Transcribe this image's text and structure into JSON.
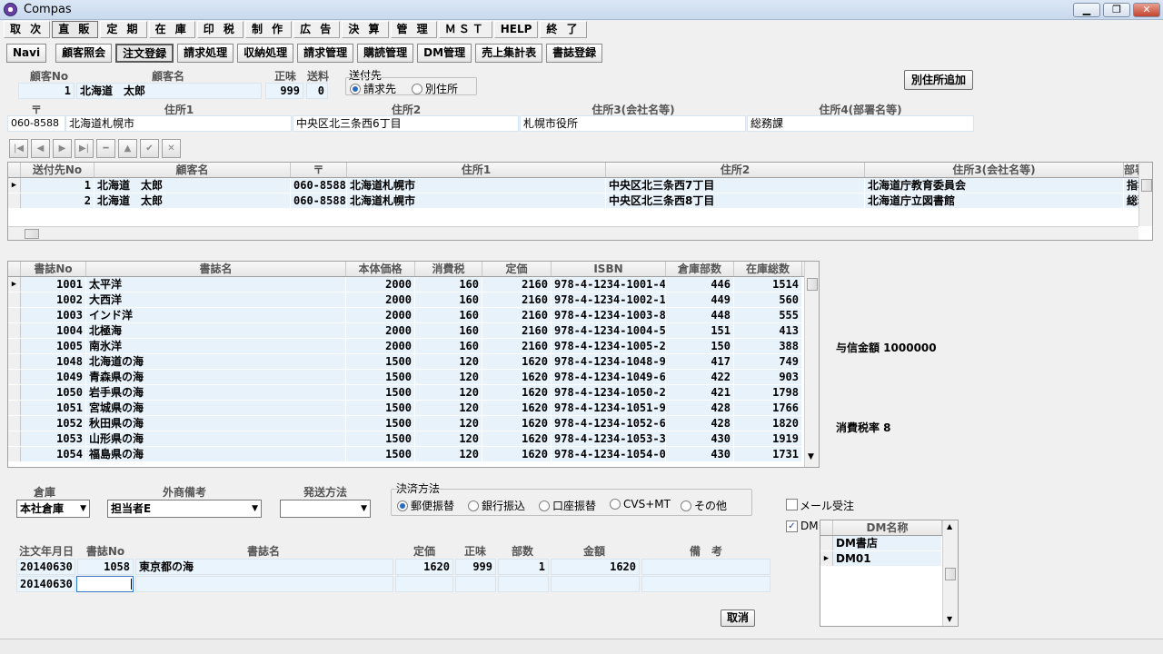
{
  "window": {
    "title": "Compas",
    "buttons": {
      "minimize": "▁",
      "restore": "❐",
      "close": "✕"
    }
  },
  "menu": [
    "取 次",
    "直 販",
    "定 期",
    "在 庫",
    "印 税",
    "制 作",
    "広 告",
    "決 算",
    "管 理",
    "ＭＳＴ",
    "HELP",
    "終 了"
  ],
  "nav": [
    "Navi",
    "顧客照会",
    "注文登録",
    "請求処理",
    "収納処理",
    "請求管理",
    "購読管理",
    "DM管理",
    "売上集計表",
    "書誌登録"
  ],
  "customer": {
    "labels": {
      "no": "顧客No",
      "name": "顧客名",
      "seimi": "正味",
      "soryo": "送料",
      "sendto": "送付先"
    },
    "no": "1",
    "name": "北海道　太郎",
    "seimi": "999",
    "soryo": "0",
    "radio": {
      "opt1": "請求先",
      "opt2": "別住所"
    },
    "add_address_button": "別住所追加"
  },
  "address": {
    "labels": {
      "zip": "〒",
      "addr1": "住所1",
      "addr2": "住所2",
      "addr3": "住所3(会社名等)",
      "addr4": "住所4(部署名等)"
    },
    "zip": "060-8588",
    "addr1": "北海道札幌市",
    "addr2": "中央区北三条西6丁目",
    "addr3": "札幌市役所",
    "addr4": "総務課"
  },
  "nav_icons": [
    "|◀",
    "◀",
    "▶",
    "▶|",
    "━",
    "▲",
    "✔",
    "✕"
  ],
  "sendto_grid": {
    "headers": [
      "送付先No",
      "顧客名",
      "〒",
      "住所1",
      "住所2",
      "住所3(会社名等)",
      "部署"
    ],
    "rows": [
      [
        "1",
        "北海道　太郎",
        "060-8588",
        "北海道札幌市",
        "中央区北三条西7丁目",
        "北海道庁教育委員会",
        "指導"
      ],
      [
        "2",
        "北海道　太郎",
        "060-8588",
        "北海道札幌市",
        "中央区北三条西8丁目",
        "北海道庁立図書館",
        "総務"
      ]
    ]
  },
  "books_grid": {
    "headers": [
      "書誌No",
      "書誌名",
      "本体価格",
      "消費税",
      "定価",
      "ISBN",
      "倉庫部数",
      "在庫総数"
    ],
    "rows": [
      [
        "1001",
        "太平洋",
        "2000",
        "160",
        "2160",
        "978-4-1234-1001-4",
        "446",
        "1514"
      ],
      [
        "1002",
        "大西洋",
        "2000",
        "160",
        "2160",
        "978-4-1234-1002-1",
        "449",
        "560"
      ],
      [
        "1003",
        "インド洋",
        "2000",
        "160",
        "2160",
        "978-4-1234-1003-8",
        "448",
        "555"
      ],
      [
        "1004",
        "北極海",
        "2000",
        "160",
        "2160",
        "978-4-1234-1004-5",
        "151",
        "413"
      ],
      [
        "1005",
        "南氷洋",
        "2000",
        "160",
        "2160",
        "978-4-1234-1005-2",
        "150",
        "388"
      ],
      [
        "1048",
        "北海道の海",
        "1500",
        "120",
        "1620",
        "978-4-1234-1048-9",
        "417",
        "749"
      ],
      [
        "1049",
        "青森県の海",
        "1500",
        "120",
        "1620",
        "978-4-1234-1049-6",
        "422",
        "903"
      ],
      [
        "1050",
        "岩手県の海",
        "1500",
        "120",
        "1620",
        "978-4-1234-1050-2",
        "421",
        "1798"
      ],
      [
        "1051",
        "宮城県の海",
        "1500",
        "120",
        "1620",
        "978-4-1234-1051-9",
        "428",
        "1766"
      ],
      [
        "1052",
        "秋田県の海",
        "1500",
        "120",
        "1620",
        "978-4-1234-1052-6",
        "428",
        "1820"
      ],
      [
        "1053",
        "山形県の海",
        "1500",
        "120",
        "1620",
        "978-4-1234-1053-3",
        "430",
        "1919"
      ],
      [
        "1054",
        "福島県の海",
        "1500",
        "120",
        "1620",
        "978-4-1234-1054-0",
        "430",
        "1731"
      ]
    ]
  },
  "side_info": {
    "credit": "与信金額 1000000",
    "tax_rate": "消費税率 8"
  },
  "options": {
    "labels": {
      "warehouse": "倉庫",
      "sales_note": "外商備考",
      "ship": "発送方法",
      "payment": "決済方法"
    },
    "warehouse": "本社倉庫",
    "sales_note": "担当者E",
    "ship": "",
    "payment_opts": [
      "郵便振替",
      "銀行振込",
      "口座振替",
      "CVS+MT",
      "その他"
    ]
  },
  "checks": {
    "mail": "メール受注",
    "dm": "DM",
    "dm_checked": "✓"
  },
  "dm_list": {
    "header": "DM名称",
    "items": [
      "DM書店",
      "DM01"
    ]
  },
  "order": {
    "headers": [
      "注文年月日",
      "書誌No",
      "書誌名",
      "定価",
      "正味",
      "部数",
      "金額",
      "備　考"
    ],
    "rows": [
      [
        "20140630",
        "1058",
        "東京都の海",
        "1620",
        "999",
        "1",
        "1620",
        ""
      ]
    ],
    "new_date": "20140630"
  },
  "cancel_button": "取消"
}
